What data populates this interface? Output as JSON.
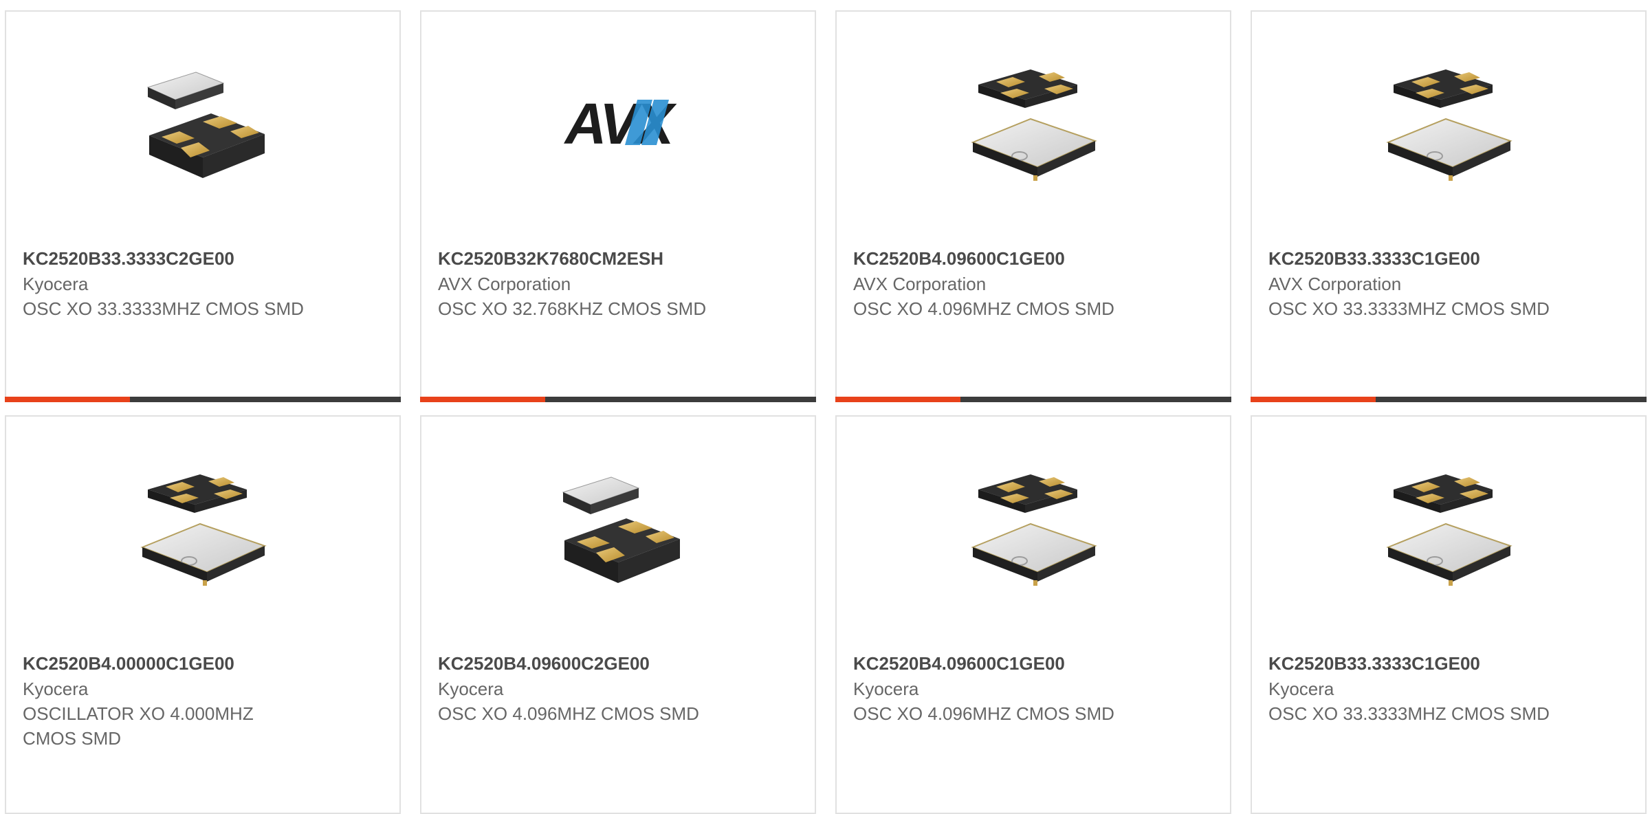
{
  "colors": {
    "accent": "#e8421a",
    "bar_dark": "#3c3c3c",
    "border": "#e1e1e1",
    "part_number": "#4a4a4a",
    "text": "#666666"
  },
  "cards": [
    {
      "part_number": "KC2520B33.3333C2GE00",
      "manufacturer": "Kyocera",
      "description": "OSC XO 33.3333MHZ CMOS SMD",
      "image": "crystal-oscillator-lid-up"
    },
    {
      "part_number": "KC2520B32K7680CM2ESH",
      "manufacturer": "AVX Corporation",
      "description": "OSC XO 32.768KHZ CMOS SMD",
      "image": "avx-logo",
      "logo_text": "AVX"
    },
    {
      "part_number": "KC2520B4.09600C1GE00",
      "manufacturer": "AVX Corporation",
      "description": "OSC XO 4.096MHZ CMOS SMD",
      "image": "crystal-oscillator-pads-up"
    },
    {
      "part_number": "KC2520B33.3333C1GE00",
      "manufacturer": "AVX Corporation",
      "description": "OSC XO 33.3333MHZ CMOS SMD",
      "image": "crystal-oscillator-pads-up"
    },
    {
      "part_number": "KC2520B4.00000C1GE00",
      "manufacturer": "Kyocera",
      "description": "OSCILLATOR XO 4.000MHZ CMOS SMD",
      "image": "crystal-oscillator-pads-up"
    },
    {
      "part_number": "KC2520B4.09600C2GE00",
      "manufacturer": "Kyocera",
      "description": "OSC XO 4.096MHZ CMOS SMD",
      "image": "crystal-oscillator-lid-up"
    },
    {
      "part_number": "KC2520B4.09600C1GE00",
      "manufacturer": "Kyocera",
      "description": "OSC XO 4.096MHZ CMOS SMD",
      "image": "crystal-oscillator-pads-up"
    },
    {
      "part_number": "KC2520B33.3333C1GE00",
      "manufacturer": "Kyocera",
      "description": "OSC XO 33.3333MHZ CMOS SMD",
      "image": "crystal-oscillator-pads-up"
    }
  ]
}
